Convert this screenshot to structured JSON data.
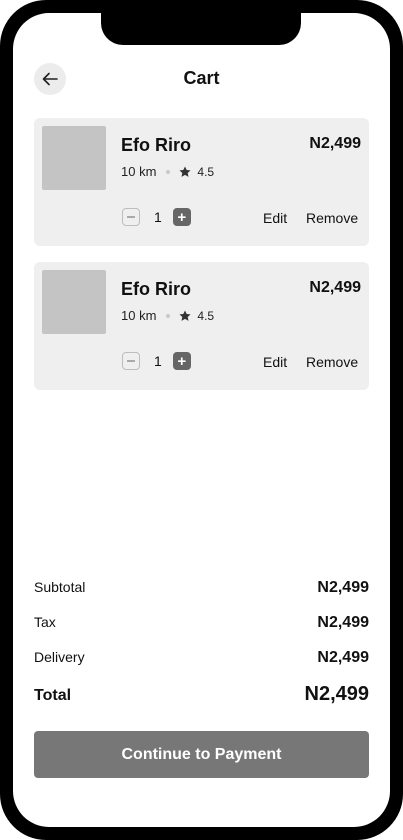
{
  "header": {
    "title": "Cart"
  },
  "cart": {
    "items": [
      {
        "name": "Efo Riro",
        "price": "N2,499",
        "distance": "10 km",
        "rating": "4.5",
        "quantity": "1",
        "edit_label": "Edit",
        "remove_label": "Remove"
      },
      {
        "name": "Efo Riro",
        "price": "N2,499",
        "distance": "10 km",
        "rating": "4.5",
        "quantity": "1",
        "edit_label": "Edit",
        "remove_label": "Remove"
      }
    ]
  },
  "summary": {
    "subtotal_label": "Subtotal",
    "subtotal_value": "N2,499",
    "tax_label": "Tax",
    "tax_value": "N2,499",
    "delivery_label": "Delivery",
    "delivery_value": "N2,499",
    "total_label": "Total",
    "total_value": "N2,499"
  },
  "actions": {
    "continue_label": "Continue to Payment"
  },
  "icons": {
    "back": "arrow-left-icon",
    "rating": "star-icon",
    "decrease": "minus-icon",
    "increase": "plus-icon"
  },
  "colors": {
    "card_bg": "#efefef",
    "thumbnail": "#c4c4c4",
    "button_bg": "#777777",
    "stepper_plus": "#666666"
  }
}
